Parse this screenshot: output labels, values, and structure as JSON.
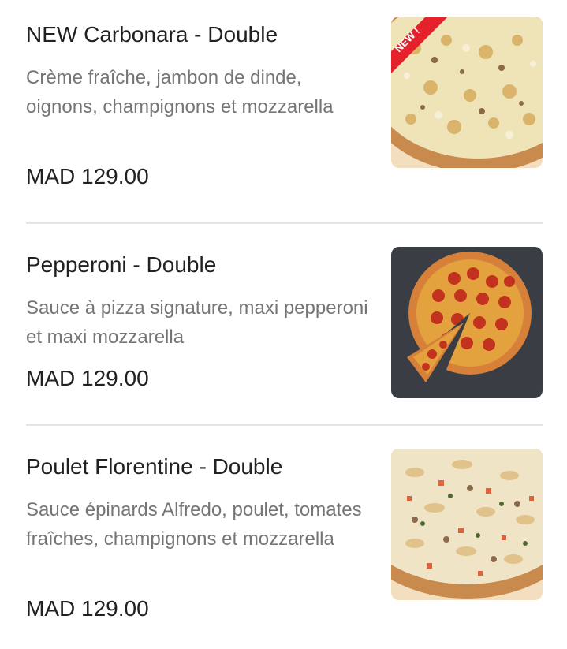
{
  "items": [
    {
      "title": "NEW Carbonara  - Double",
      "description": "Crème fraîche, jambon de dinde, oignons, champignons et mozzarella",
      "price": "MAD 129.00",
      "badge": "NEW !",
      "image_icon": "pizza-carbonara-image"
    },
    {
      "title": "Pepperoni - Double",
      "description": "Sauce à pizza signature, maxi pepperoni et maxi mozzarella",
      "price": "MAD 129.00",
      "image_icon": "pizza-pepperoni-image"
    },
    {
      "title": "Poulet Florentine - Double",
      "description": "Sauce épinards Alfredo, poulet, tomates fraîches, champignons et mozzarella",
      "price": "MAD 129.00",
      "image_icon": "pizza-florentine-image"
    }
  ],
  "colors": {
    "title": "#202124",
    "description": "#757575",
    "divider": "#e4e4e4",
    "badge": "#e5212b"
  }
}
